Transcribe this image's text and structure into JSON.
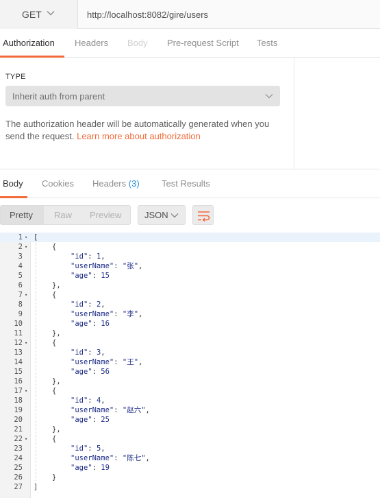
{
  "request": {
    "method": "GET",
    "url": "http://localhost:8082/gire/users"
  },
  "request_tabs": [
    {
      "label": "Authorization",
      "state": "active"
    },
    {
      "label": "Headers",
      "state": "normal"
    },
    {
      "label": "Body",
      "state": "disabled"
    },
    {
      "label": "Pre-request Script",
      "state": "normal"
    },
    {
      "label": "Tests",
      "state": "normal"
    }
  ],
  "auth": {
    "type_label": "TYPE",
    "type_value": "Inherit auth from parent",
    "description": "The authorization header will be automatically generated when you send the request.",
    "learn_more": "Learn more about authorization"
  },
  "response_tabs": [
    {
      "label": "Body",
      "state": "active"
    },
    {
      "label": "Cookies",
      "state": "normal"
    },
    {
      "label": "Headers",
      "count": "(3)",
      "state": "normal"
    },
    {
      "label": "Test Results",
      "state": "normal"
    }
  ],
  "toolbar": {
    "view_modes": [
      "Pretty",
      "Raw",
      "Preview"
    ],
    "selected_view": "Pretty",
    "format": "JSON"
  },
  "colors": {
    "accent": "#f26b3a",
    "count": "#2a8fd6",
    "json_value": "#1e2d87"
  },
  "response_users": [
    {
      "id": 1,
      "userName": "张",
      "age": 15
    },
    {
      "id": 2,
      "userName": "李",
      "age": 16
    },
    {
      "id": 3,
      "userName": "王",
      "age": 56
    },
    {
      "id": 4,
      "userName": "赵六",
      "age": 25
    },
    {
      "id": 5,
      "userName": "陈七",
      "age": 19
    }
  ]
}
